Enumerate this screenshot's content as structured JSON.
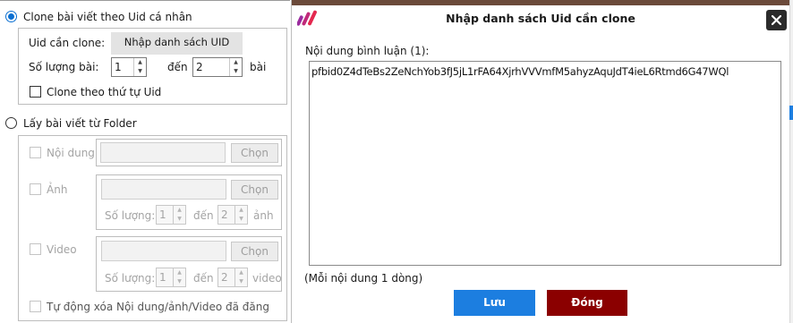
{
  "left_panel": {
    "clone_by_uid": {
      "label": "Clone bài viết theo Uid cá nhân",
      "uid_label": "Uid cần clone:",
      "import_button": "Nhập danh sách UID",
      "count_label": "Số lượng bài:",
      "count_from": "1",
      "to_label": "đến",
      "count_to": "2",
      "posts_label": "bài",
      "order_checkbox_label": "Clone theo thứ tự Uid"
    },
    "from_folder": {
      "label": "Lấy bài viết từ Folder",
      "content_label": "Nội dung",
      "choose_button": "Chọn",
      "image_label": "Ảnh",
      "image_count_label": "Số lượng:",
      "image_from": "1",
      "image_to_label": "đến",
      "image_to": "2",
      "image_unit": "ảnh",
      "video_label": "Video",
      "video_count_label": "Số lượng:",
      "video_from": "1",
      "video_to_label": "đến",
      "video_to": "2",
      "video_unit": "video",
      "auto_delete_label": "Tự động xóa Nội dung/ảnh/Video đã đăng"
    }
  },
  "dialog": {
    "title": "Nhập danh sách Uid cần clone",
    "close_icon": "close-icon",
    "content_label": "Nội dung bình luận (1):",
    "content_value": "pfbid0Z4dTeBs2ZeNchYob3fJ5jL1rFA64XjrhVVVmfM5ahyzAquJdT4ieL6Rtmd6G47WQl",
    "hint": "(Mỗi nội dung 1 dòng)",
    "save_button": "Lưu",
    "close_button": "Đóng"
  },
  "colors": {
    "accent_blue": "#1c7ee0",
    "close_red": "#8b0000",
    "radio_blue": "#0b6fd1",
    "logo_purple": "#9b2c9f",
    "logo_red": "#e4284f"
  }
}
